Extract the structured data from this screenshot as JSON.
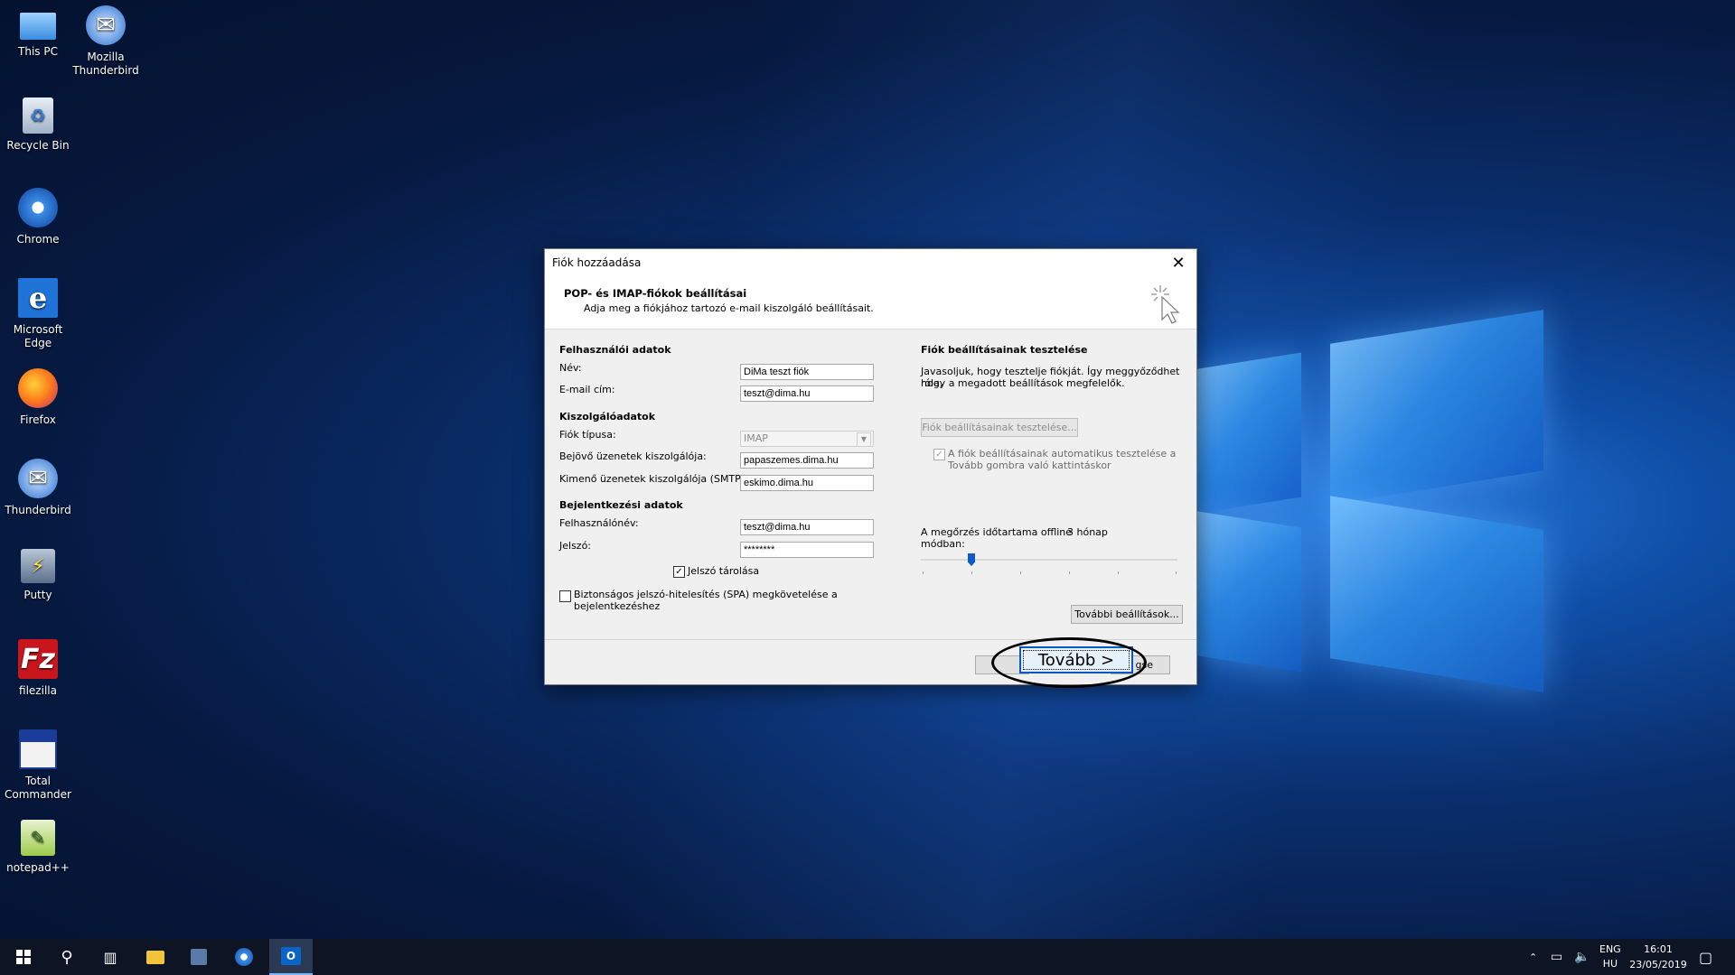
{
  "desktop": {
    "icons": [
      {
        "label": "This PC"
      },
      {
        "label": "Mozilla Thunderbird"
      },
      {
        "label": "Recycle Bin"
      },
      {
        "label": "Chrome"
      },
      {
        "label": "Microsoft Edge"
      },
      {
        "label": "Firefox"
      },
      {
        "label": "Thunderbird"
      },
      {
        "label": "Putty"
      },
      {
        "label": "filezilla"
      },
      {
        "label": "Total Commander"
      },
      {
        "label": "notepad++"
      }
    ]
  },
  "dialog": {
    "title": "Fiók hozzáadása",
    "header_title": "POP- és IMAP-fiókok beállításai",
    "header_subtitle": "Adja meg a fiókjához tartozó e-mail kiszolgáló beállításait.",
    "user_section": "Felhasználói adatok",
    "name_label": "Név:",
    "name_value": "DiMa teszt fiók",
    "email_label": "E-mail cím:",
    "email_value": "teszt@dima.hu",
    "server_section": "Kiszolgálóadatok",
    "account_type_label": "Fiók típusa:",
    "account_type_value": "IMAP",
    "incoming_label": "Bejövő üzenetek kiszolgálója:",
    "incoming_value": "papaszemes.dima.hu",
    "outgoing_label": "Kimenő üzenetek kiszolgálója (SMTP):",
    "outgoing_value": "eskimo.dima.hu",
    "login_section": "Bejelentkezési adatok",
    "username_label": "Felhasználónév:",
    "username_value": "teszt@dima.hu",
    "password_label": "Jelszó:",
    "password_value": "********",
    "remember_password_label": "Jelszó tárolása",
    "remember_password_checked": true,
    "spa_label_line1": "Biztonságos jelszó-hitelesítés (SPA) megkövetelése a",
    "spa_label_line2": "bejelentkezéshez",
    "spa_checked": false,
    "test_section": "Fiók beállításainak tesztelése",
    "test_desc_line1": "Javasoljuk, hogy tesztelje fiókját. Így meggyőződhet róla,",
    "test_desc_line2": "hogy a megadott beállítások megfelelők.",
    "test_button": "Fiók beállításainak tesztelése...",
    "auto_test_line1": "A fiók beállításainak automatikus tesztelése a",
    "auto_test_line2": "Tovább gombra való kattintáskor",
    "auto_test_checked": true,
    "offline_label_line1": "A megőrzés időtartama offline",
    "offline_label_line2": "módban:",
    "offline_value": "3 hónap",
    "offline_slider_fraction": 0.17,
    "more_settings_button": "További beállítások...",
    "next_button": "Tovább >",
    "cancel_button_partial": "gse",
    "close_icon": "close-icon"
  },
  "taskbar": {
    "language_line1": "ENG",
    "language_line2": "HU",
    "time": "16:01",
    "date": "23/05/2019"
  },
  "colors": {
    "accent": "#0a58c4",
    "taskbar": "#0d1524"
  }
}
